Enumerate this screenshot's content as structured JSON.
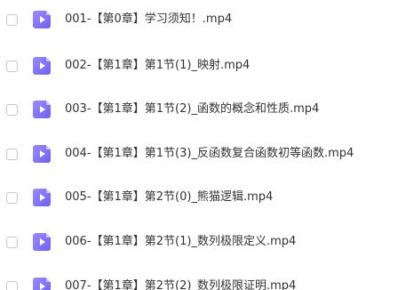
{
  "files": [
    {
      "name": "001-【第0章】学习须知！.mp4",
      "icon": "video-file-icon"
    },
    {
      "name": "002-【第1章】第1节(1)_映射.mp4",
      "icon": "video-file-icon"
    },
    {
      "name": "003-【第1章】第1节(2)_函数的概念和性质.mp4",
      "icon": "video-file-icon"
    },
    {
      "name": "004-【第1章】第1节(3)_反函数复合函数初等函数.mp4",
      "icon": "video-file-icon"
    },
    {
      "name": "005-【第1章】第2节(0)_熊猫逻辑.mp4",
      "icon": "video-file-icon"
    },
    {
      "name": "006-【第1章】第2节(1)_数列极限定义.mp4",
      "icon": "video-file-icon"
    },
    {
      "name": "007-【第1章】第2节(2)_数列极限证明.mp4",
      "icon": "video-file-icon"
    }
  ],
  "colors": {
    "icon_accent": "#7b6cf2",
    "text": "#333333",
    "checkbox_border": "#c6c6c6"
  }
}
